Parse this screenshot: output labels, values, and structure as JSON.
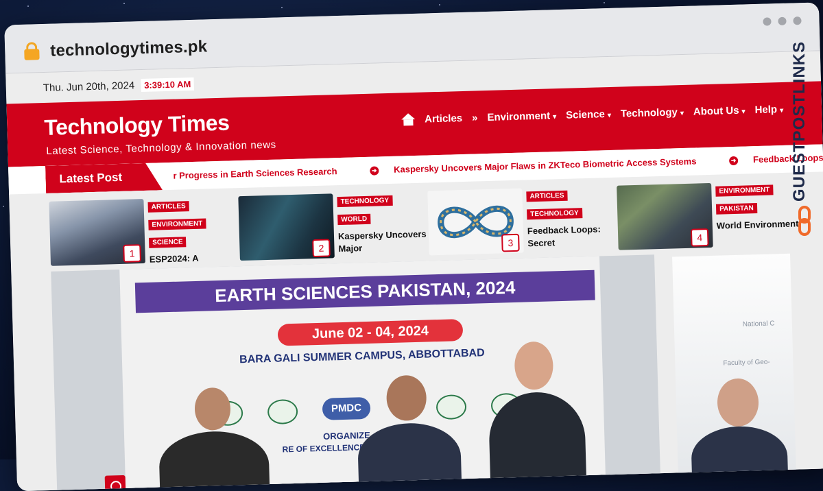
{
  "browser": {
    "url": "technologytimes.pk",
    "icons": [
      "lock-icon"
    ]
  },
  "topbar": {
    "date": "Thu. Jun 20th, 2024",
    "time": "3:39:10 AM"
  },
  "header": {
    "logo": "Technology Times",
    "tagline": "Latest Science, Technology & Innovation news"
  },
  "nav": {
    "items": [
      {
        "label": "Articles"
      },
      {
        "label": "»"
      },
      {
        "label": "Environment",
        "dropdown": true
      },
      {
        "label": "Science",
        "dropdown": true
      },
      {
        "label": "Technology",
        "dropdown": true
      },
      {
        "label": "About Us",
        "dropdown": true
      },
      {
        "label": "Help",
        "dropdown": true
      }
    ],
    "caret": "▾"
  },
  "ticker": {
    "label": "Latest Post",
    "items": [
      "r Progress in Earth Sciences Research",
      "Kaspersky Uncovers Major Flaws in ZKTeco Biometric Access Systems",
      "Feedback Loops: Secr"
    ]
  },
  "cards": [
    {
      "num": "1",
      "tags": [
        "ARTICLES",
        "ENVIRONMENT",
        "SCIENCE"
      ],
      "title": "ESP2024: A"
    },
    {
      "num": "2",
      "tags": [
        "TECHNOLOGY",
        "WORLD"
      ],
      "title": "Kaspersky Uncovers Major"
    },
    {
      "num": "3",
      "tags": [
        "ARTICLES",
        "TECHNOLOGY"
      ],
      "title": "Feedback Loops: Secret"
    },
    {
      "num": "4",
      "tags": [
        "ENVIRONMENT",
        "PAKISTAN"
      ],
      "title": "World Environment"
    }
  ],
  "hero": {
    "banner_title": "EARTH SCIENCES PAKISTAN, 2024",
    "banner_dates": "June 02 - 04, 2024",
    "banner_campus": "BARA GALI SUMMER CAMPUS, ABBOTTABAD",
    "organized": "ORGANIZE",
    "excellence": "RE OF EXCELLENCE          RSITY",
    "pmdc": "PMDC"
  },
  "sidebar_image": {
    "line1": "National C",
    "line2": "Faculty of Geo-"
  },
  "watermark": {
    "text": "GUESTPOSTLINKS"
  },
  "colors": {
    "brand_red": "#d0021b",
    "banner_purple": "#5b3e9b",
    "watermark_orange": "#f06a2a"
  }
}
